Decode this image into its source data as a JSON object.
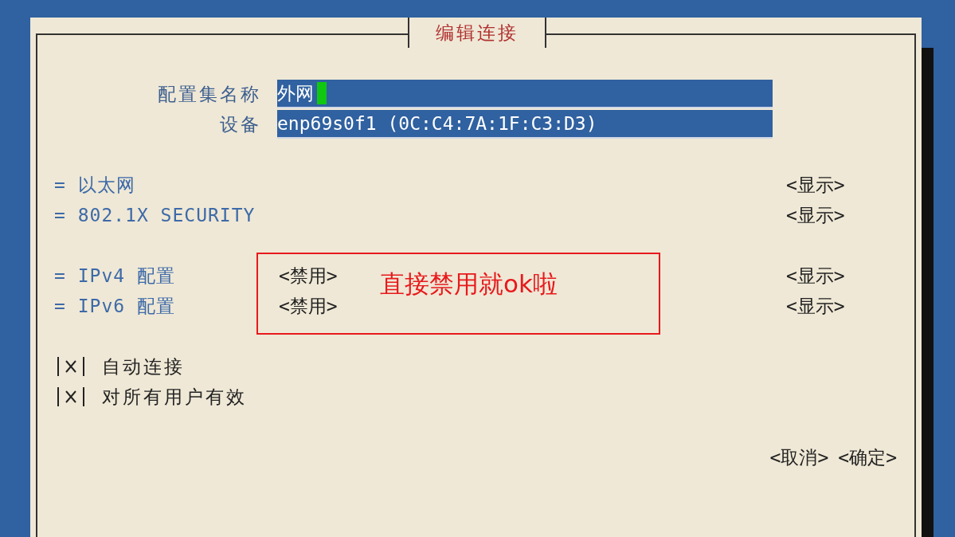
{
  "dialog": {
    "title": "编辑连接",
    "fields": [
      {
        "label": "配置集名称",
        "value": "外网",
        "focused": true
      },
      {
        "label": "设备",
        "value": "enp69s0f1 (0C:C4:7A:1F:C3:D3)",
        "focused": false
      }
    ],
    "section_groups": [
      [
        {
          "name": "= 以太网",
          "show": "<显示>"
        },
        {
          "name": "= 802.1X SECURITY",
          "show": "<显示>"
        }
      ],
      [
        {
          "name": "= IPv4 配置",
          "mode": "<禁用>",
          "show": "<显示>"
        },
        {
          "name": "= IPv6 配置",
          "mode": "<禁用>",
          "show": "<显示>"
        }
      ]
    ],
    "checkboxes": [
      {
        "label": "自动连接",
        "checked": true
      },
      {
        "label": "对所有用户有效",
        "checked": true
      }
    ],
    "buttons": [
      "<取消>",
      "<确定>"
    ]
  },
  "annotation": {
    "text": "直接禁用就ok啦"
  }
}
